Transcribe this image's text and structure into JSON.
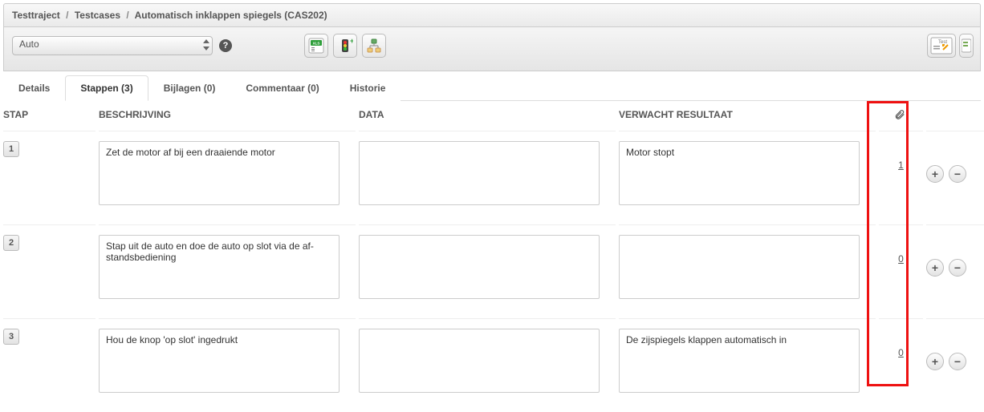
{
  "breadcrumb": {
    "level1": "Testtraject",
    "level2": "Testcases",
    "level3": "Automatisch inklappen spiegels (CAS202)"
  },
  "toolbar": {
    "mode_selected": "Auto",
    "icons": {
      "help": "?",
      "export_xls": "XLS",
      "traffic": "traffic-light",
      "tree": "tree-view",
      "test_label": "Test"
    }
  },
  "tabs": [
    {
      "id": "details",
      "label": "Details",
      "active": false
    },
    {
      "id": "steps",
      "label": "Stappen (3)",
      "active": true
    },
    {
      "id": "bijlagen",
      "label": "Bijlagen (0)",
      "active": false
    },
    {
      "id": "commentaar",
      "label": "Commentaar (0)",
      "active": false
    },
    {
      "id": "historie",
      "label": "Historie",
      "active": false
    }
  ],
  "columns": {
    "step": "STAP",
    "description": "BESCHRIJVING",
    "data": "DATA",
    "expected": "VERWACHT RESULTAAT",
    "attachment": "attachment-icon"
  },
  "steps": [
    {
      "num": "1",
      "description": "Zet de motor af bij een draaiende motor",
      "data": "",
      "expected": "Motor stopt",
      "attachments": "1"
    },
    {
      "num": "2",
      "description": "Stap uit de auto en doe de auto op slot via de af-standsbediening",
      "data": "",
      "expected": "",
      "attachments": "0"
    },
    {
      "num": "3",
      "description": "Hou de knop 'op slot' ingedrukt",
      "data": "",
      "expected": "De zijspiegels klappen automatisch in",
      "attachments": "0"
    }
  ],
  "row_actions": {
    "plus": "+",
    "minus": "−"
  }
}
